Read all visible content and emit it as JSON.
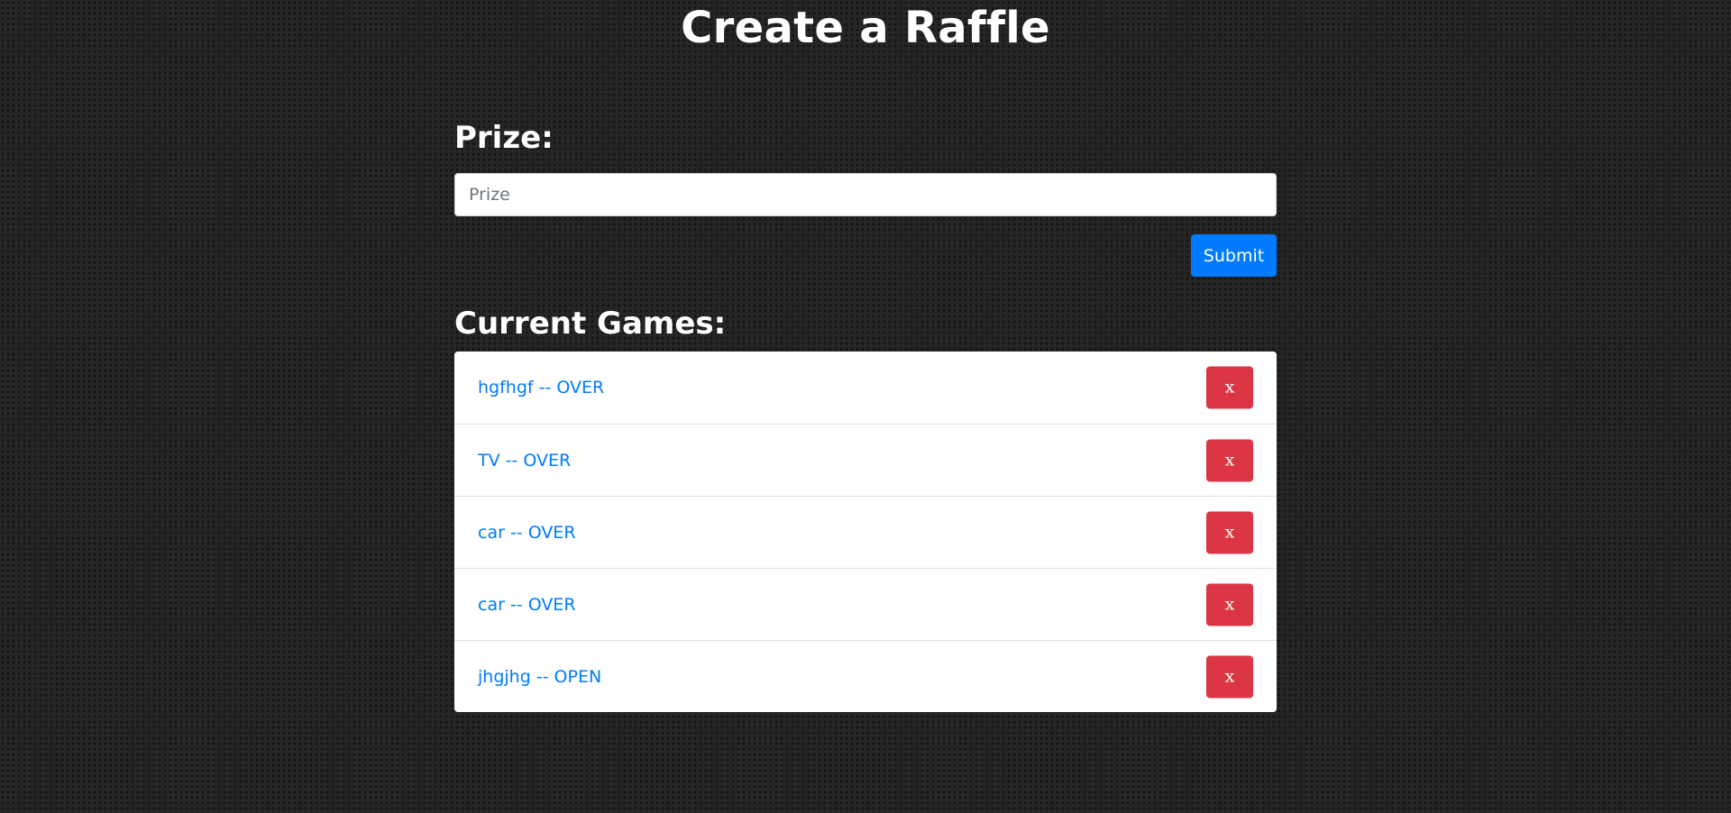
{
  "header": {
    "title": "Create a Raffle"
  },
  "form": {
    "prize_label": "Prize:",
    "prize_input": {
      "value": "",
      "placeholder": "Prize"
    },
    "submit_label": "Submit"
  },
  "games": {
    "heading": "Current Games:",
    "items": [
      {
        "label": "hgfhgf -- OVER",
        "delete_label": "x"
      },
      {
        "label": "TV -- OVER",
        "delete_label": "x"
      },
      {
        "label": "car -- OVER",
        "delete_label": "x"
      },
      {
        "label": "car -- OVER",
        "delete_label": "x"
      },
      {
        "label": "jhgjhg -- OPEN",
        "delete_label": "x"
      }
    ]
  },
  "colors": {
    "primary": "#007bff",
    "danger": "#dc3545",
    "background": "#262626"
  }
}
